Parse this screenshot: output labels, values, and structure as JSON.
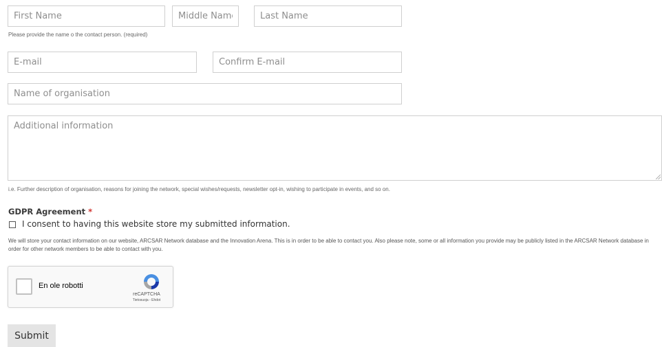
{
  "name_row": {
    "first_name_placeholder": "First Name",
    "middle_name_placeholder": "Middle Name",
    "last_name_placeholder": "Last Name",
    "help": "Please provide the name o the contact person. (required)"
  },
  "email_row": {
    "email_placeholder": "E-mail",
    "confirm_email_placeholder": "Confirm E-mail"
  },
  "organisation_placeholder": "Name of organisation",
  "additional": {
    "placeholder": "Additional information",
    "help": "i.e. Further description of organisation, reasons for joining the network, special wishes/requests, newsletter opt-in, wishing to participate in events, and so on."
  },
  "gdpr": {
    "title": "GDPR Agreement",
    "required_marker": "*",
    "consent_label": "I consent to having this website store my submitted information.",
    "description": "We will store your contact information on our website, ARCSAR Network database and the Innovation Arena. This is in order to be able to contact you. Also please note, some or all information you provide may be publicly listed in the ARCSAR Network database in order for other network members to be able to contact with you."
  },
  "recaptcha": {
    "label": "En ole robotti",
    "brand": "reCAPTCHA",
    "links": "Tietosuoja - Ehdot",
    "icon": "recaptcha-logo-icon"
  },
  "submit_label": "Submit"
}
